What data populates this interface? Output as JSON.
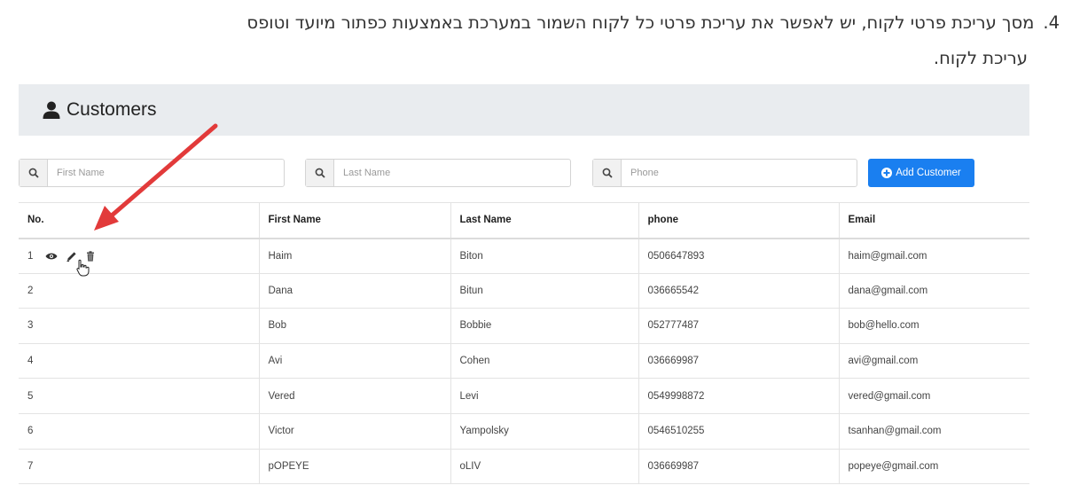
{
  "instruction": {
    "number": "4.",
    "line1": "מסך עריכת פרטי לקוח, יש לאפשר את עריכת פרטי כל לקוח השמור במערכת באמצעות כפתור מיועד וטופס",
    "line2": "עריכת לקוח."
  },
  "page": {
    "title": "Customers",
    "icon": "user-icon"
  },
  "filters": {
    "first_name_placeholder": "First Name",
    "last_name_placeholder": "Last Name",
    "phone_placeholder": "Phone",
    "search_icon": "search-icon"
  },
  "add_button": {
    "label": "Add Customer",
    "icon": "plus-circle-icon",
    "color": "#1a7ff0"
  },
  "table": {
    "headers": {
      "no": "No.",
      "first_name": "First Name",
      "last_name": "Last Name",
      "phone": "phone",
      "email": "Email"
    },
    "row_action_icons": [
      "eye-icon",
      "pencil-icon",
      "trash-icon"
    ],
    "rows": [
      {
        "no": "1",
        "first_name": "Haim",
        "last_name": "Biton",
        "phone": "0506647893",
        "email": "haim@gmail.com"
      },
      {
        "no": "2",
        "first_name": "Dana",
        "last_name": "Bitun",
        "phone": "036665542",
        "email": "dana@gmail.com"
      },
      {
        "no": "3",
        "first_name": "Bob",
        "last_name": "Bobbie",
        "phone": "052777487",
        "email": "bob@hello.com"
      },
      {
        "no": "4",
        "first_name": "Avi",
        "last_name": "Cohen",
        "phone": "036669987",
        "email": "avi@gmail.com"
      },
      {
        "no": "5",
        "first_name": "Vered",
        "last_name": "Levi",
        "phone": "0549998872",
        "email": "vered@gmail.com"
      },
      {
        "no": "6",
        "first_name": "Victor",
        "last_name": "Yampolsky",
        "phone": "0546510255",
        "email": "tsanhan@gmail.com"
      },
      {
        "no": "7",
        "first_name": "pOPEYE",
        "last_name": "oLIV",
        "phone": "036669987",
        "email": "popeye@gmail.com"
      }
    ]
  },
  "annotation": {
    "arrow_color": "#e23a3a",
    "target": "pencil-icon"
  }
}
